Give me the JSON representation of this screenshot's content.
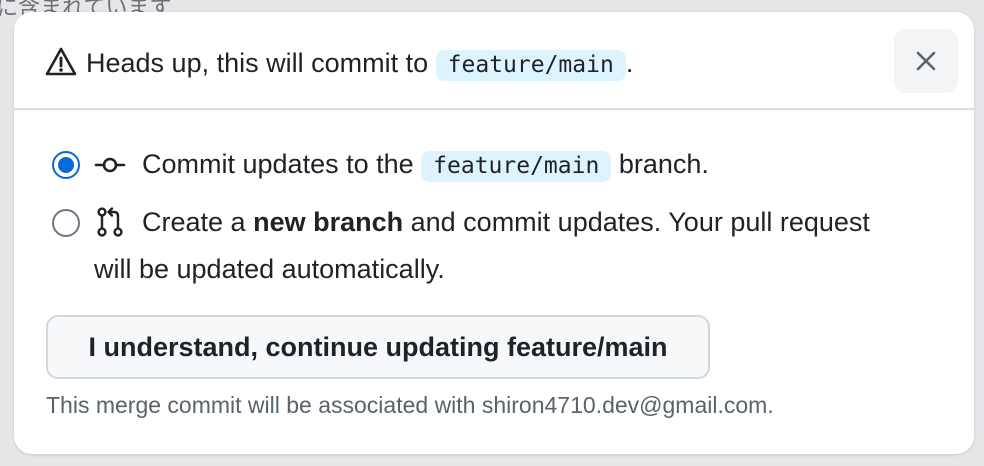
{
  "background": {
    "text": "に含まれています"
  },
  "dialog": {
    "header": {
      "text_before": "Heads up, this will commit to",
      "branch": "feature/main",
      "text_after": ".",
      "close_label": "×"
    },
    "options": [
      {
        "selected": true,
        "icon": "commit-icon",
        "text_before": "Commit updates to the",
        "branch": "feature/main",
        "text_after": "branch."
      },
      {
        "selected": false,
        "icon": "pull-request-icon",
        "text_before": "Create a",
        "bold": "new branch",
        "text_after": "and commit updates. Your pull request",
        "line2": "will be updated automatically."
      }
    ],
    "confirm_button": "I understand, continue updating feature/main",
    "footer_note": "This merge commit will be associated with shiron4710.dev@gmail.com."
  },
  "colors": {
    "accent": "#0969da",
    "code_bg": "#ddf4ff",
    "muted_text": "#59636e"
  }
}
